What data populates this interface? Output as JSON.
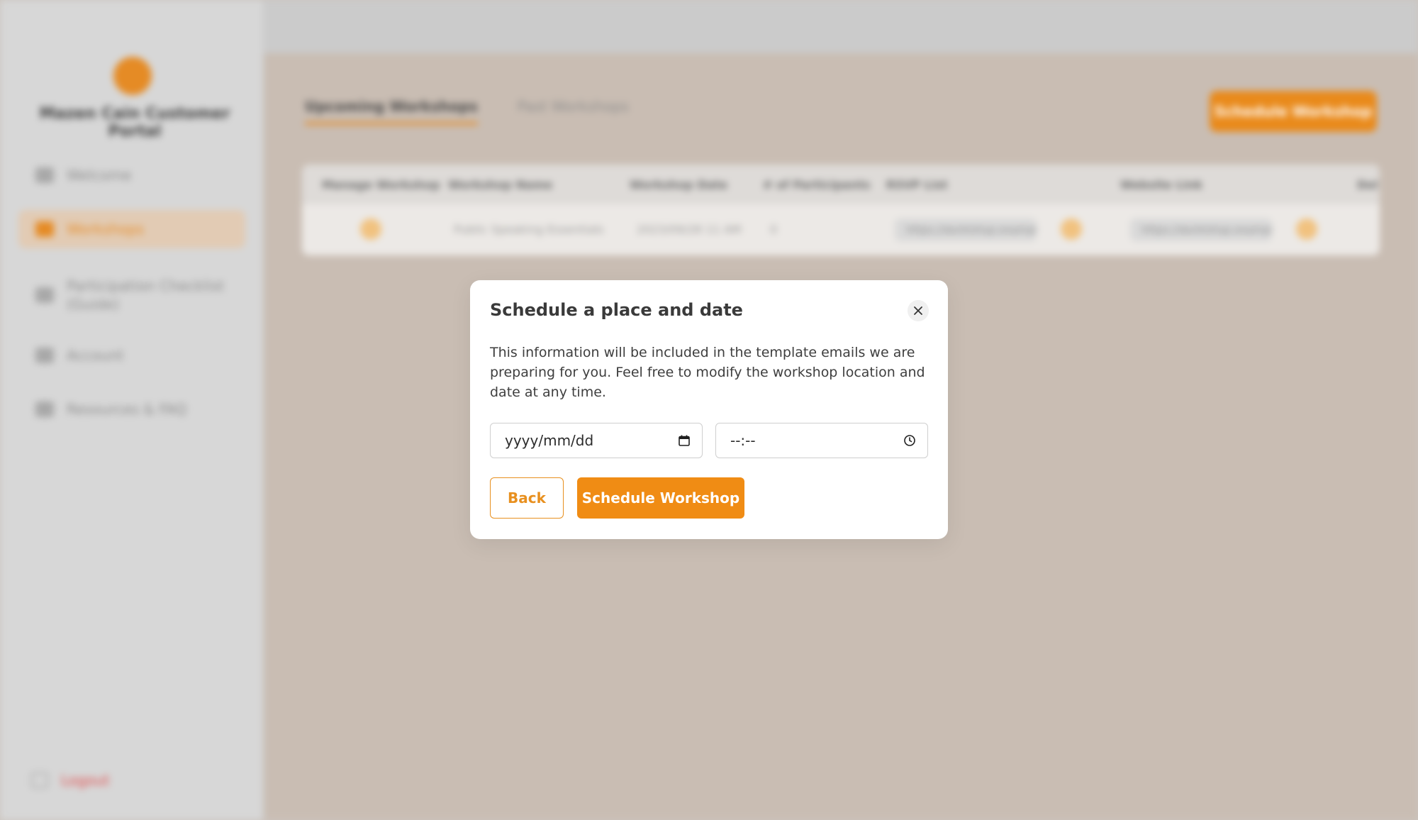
{
  "background": {
    "brand_name": "Mazen Cain Customer Portal",
    "nav": [
      {
        "label": "Welcome",
        "icon": "grid-icon",
        "active": false
      },
      {
        "label": "Workshops",
        "icon": "calendar-icon",
        "active": true
      },
      {
        "label": "Participation Checklist (Guide)",
        "icon": "checklist-icon",
        "active": false
      },
      {
        "label": "Account",
        "icon": "user-icon",
        "active": false
      },
      {
        "label": "Resources & FAQ",
        "icon": "book-icon",
        "active": false
      }
    ],
    "logout_label": "Logout",
    "tabs": [
      "Upcoming Workshops",
      "Past Workshops"
    ],
    "create_button": "Schedule Workshop",
    "table_headers": [
      "Manage Workshop",
      "Workshop Name",
      "Workshop Date",
      "# of Participants",
      "RSVP List",
      "Website Link",
      "Del"
    ],
    "table_row": {
      "name": "Public Speaking Essentials",
      "date": "2023/09/28 11 AM",
      "participants": "0",
      "rsvp": "https://workshop.example.com/rsvp",
      "website": "https://workshop.example.com/info"
    }
  },
  "modal": {
    "title": "Schedule a place and date",
    "description": "This information will be included in the template emails we are preparing for you. Feel free to modify the workshop location and date at any time.",
    "date_placeholder": "yyyy/mm/dd",
    "time_placeholder": "--:--",
    "back_label": "Back",
    "schedule_label": "Schedule Workshop"
  },
  "colors": {
    "accent": "#f08c14",
    "text": "#3a3a3a",
    "overlay": "#c9bdb3"
  }
}
